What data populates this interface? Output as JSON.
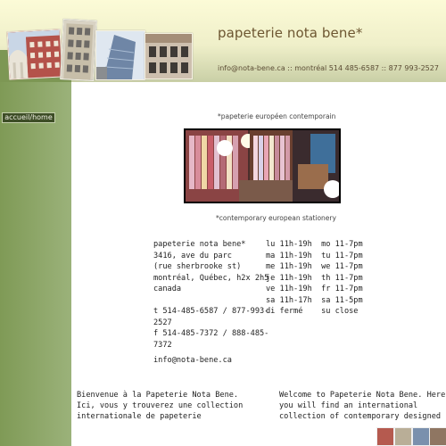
{
  "header": {
    "title": "papeterie nota bene*",
    "contact": "info@nota-bene.ca :: montréal 514 485-6587 :: 877 993-2527"
  },
  "sidebar": {
    "items": [
      {
        "label": "accueil/home"
      }
    ]
  },
  "main": {
    "tagline_fr": "*papeterie européen contemporain",
    "tagline_en": "*contemporary european stationery",
    "address_lines": [
      "papeterie nota bene*",
      "3416, ave du parc",
      "(rue sherbrooke st)",
      "montréal, Québec, h2x 2h5",
      "canada",
      "",
      "t 514-485-6587 / 877-993-",
      "2527",
      "f 514-485-7372 / 888-485-",
      "7372"
    ],
    "hours_lines": [
      "lu 11h-19h  mo 11-7pm",
      "ma 11h-19h  tu 11-7pm",
      "me 11h-19h  we 11-7pm",
      "je 11h-19h  th 11-7pm",
      "ve 11h-19h  fr 11-7pm",
      "sa 11h-17h  sa 11-5pm",
      "di fermé    su close"
    ],
    "email": "info@nota-bene.ca",
    "welcome_fr": [
      "Bienvenue à la Papeterie Nota Bene.",
      "Ici, vous y trouverez une collection",
      "internationale de papeterie"
    ],
    "welcome_en": [
      "Welcome to Papeterie Nota Bene. Here",
      "you will find an international",
      "collection of contemporary designed"
    ]
  },
  "colors": {
    "sidebar": "#7f9a56",
    "header": "#efefc9",
    "title_text": "#6d5631",
    "nav_active_bg": "#3d4d26"
  }
}
